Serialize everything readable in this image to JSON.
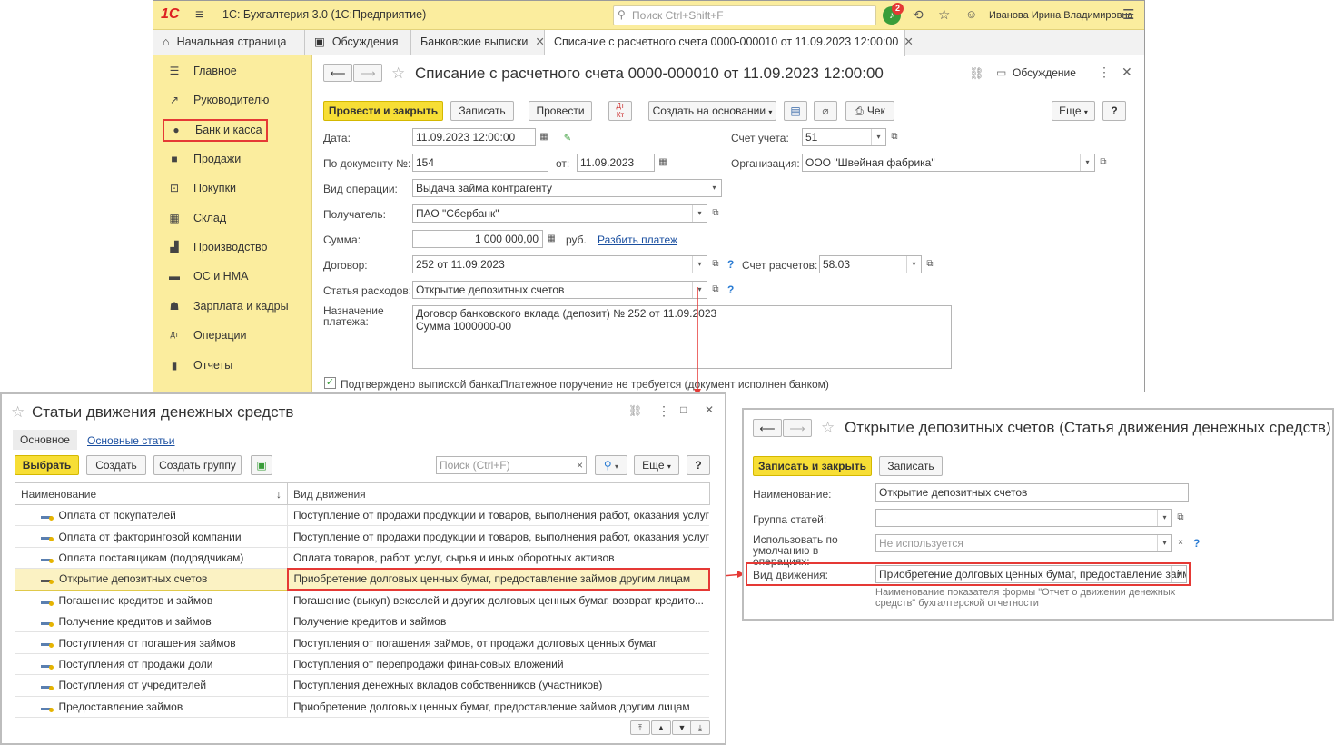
{
  "app": {
    "title": "1С: Бухгалтерия 3.0  (1С:Предприятие)",
    "search_placeholder": "Поиск Ctrl+Shift+F",
    "notifications_count": "2",
    "user": "Иванова Ирина Владимировна",
    "logo_text": "1С"
  },
  "tabs": [
    "Начальная страница",
    "Обсуждения",
    "Банковские выписки",
    "Списание с расчетного счета 0000-000010 от 11.09.2023 12:00:00"
  ],
  "sidebar": {
    "items": [
      "Главное",
      "Руководителю",
      "Банк и касса",
      "Продажи",
      "Покупки",
      "Склад",
      "Производство",
      "ОС и НМА",
      "Зарплата и кадры",
      "Операции",
      "Отчеты"
    ]
  },
  "doc": {
    "title": "Списание с расчетного счета 0000-000010 от 11.09.2023 12:00:00",
    "discussion": "Обсуждение",
    "buttons": {
      "post_close": "Провести и закрыть",
      "save": "Записать",
      "post": "Провести",
      "create_based": "Создать на основании",
      "check": "Чек",
      "more": "Еще",
      "help": "?"
    },
    "labels": {
      "date": "Дата:",
      "doc_no": "По документу №:",
      "from": "от:",
      "operation": "Вид операции:",
      "recipient": "Получатель:",
      "sum": "Сумма:",
      "currency": "руб.",
      "split": "Разбить платеж",
      "contract": "Договор:",
      "account_settle": "Счет расчетов:",
      "expense": "Статья расходов:",
      "purpose": "Назначение платежа:",
      "account": "Счет учета:",
      "org": "Организация:",
      "confirmed": "Подтверждено выпиской банка:",
      "no_order": "Платежное поручение не требуется (документ исполнен банком)"
    },
    "values": {
      "date": "11.09.2023 12:00:00",
      "doc_no": "154",
      "doc_date": "11.09.2023",
      "operation": "Выдача займа контрагенту",
      "recipient": "ПАО \"Сбербанк\"",
      "sum": "1 000 000,00",
      "contract": "252 от 11.09.2023",
      "account_settle": "58.03",
      "expense": "Открытие депозитных счетов",
      "purpose_line1": "Договор банковского вклада (депозит) № 252 от 11.09.2023",
      "purpose_line2": "Сумма 1000000-00",
      "account": "51",
      "org": "ООО \"Швейная фабрика\""
    }
  },
  "list_panel": {
    "title": "Статьи движения денежных средств",
    "tab_main": "Основное",
    "tab_link": "Основные статьи",
    "buttons": {
      "select": "Выбрать",
      "create": "Создать",
      "create_group": "Создать группу",
      "more": "Еще",
      "help": "?"
    },
    "search_placeholder": "Поиск (Ctrl+F)",
    "columns": [
      "Наименование",
      "Вид движения"
    ],
    "rows": [
      [
        "Оплата от покупателей",
        "Поступление от продажи продукции и товаров, выполнения работ, оказания услуг"
      ],
      [
        "Оплата от факторинговой компании",
        "Поступление от продажи продукции и товаров, выполнения работ, оказания услуг"
      ],
      [
        "Оплата поставщикам (подрядчикам)",
        "Оплата товаров, работ, услуг, сырья и иных оборотных активов"
      ],
      [
        "Открытие депозитных счетов",
        "Приобретение долговых ценных бумаг, предоставление займов другим лицам"
      ],
      [
        "Погашение кредитов и займов",
        "Погашение (выкуп) векселей и других долговых ценных бумаг, возврат кредито..."
      ],
      [
        "Получение кредитов и займов",
        "Получение кредитов и займов"
      ],
      [
        "Поступления от погашения займов",
        "Поступления от погашения займов, от продажи долговых ценных бумаг"
      ],
      [
        "Поступления от продажи доли",
        "Поступления от перепродажи финансовых вложений"
      ],
      [
        "Поступления от учредителей",
        "Поступления денежных вкладов собственников (участников)"
      ],
      [
        "Предоставление займов",
        "Приобретение долговых ценных бумаг, предоставление займов другим лицам"
      ]
    ]
  },
  "item_panel": {
    "title": "Открытие депозитных счетов (Статья движения денежных средств)",
    "buttons": {
      "save_close": "Записать и закрыть",
      "save": "Записать"
    },
    "labels": {
      "name": "Наименование:",
      "group": "Группа статей:",
      "default_use": "Использовать по умолчанию в операциях:",
      "movement": "Вид движения:",
      "note": "Наименование показателя формы \"Отчет о движении денежных средств\" бухгалтерской отчетности"
    },
    "values": {
      "name": "Открытие депозитных счетов",
      "group": "",
      "default_use_placeholder": "Не используется",
      "movement": "Приобретение долговых ценных бумаг, предоставление займов другим лицам"
    }
  },
  "colors": {
    "accent_yellow": "#f7de35",
    "highlight_red": "#e53935",
    "sidebar_bg": "#fbed9e"
  }
}
